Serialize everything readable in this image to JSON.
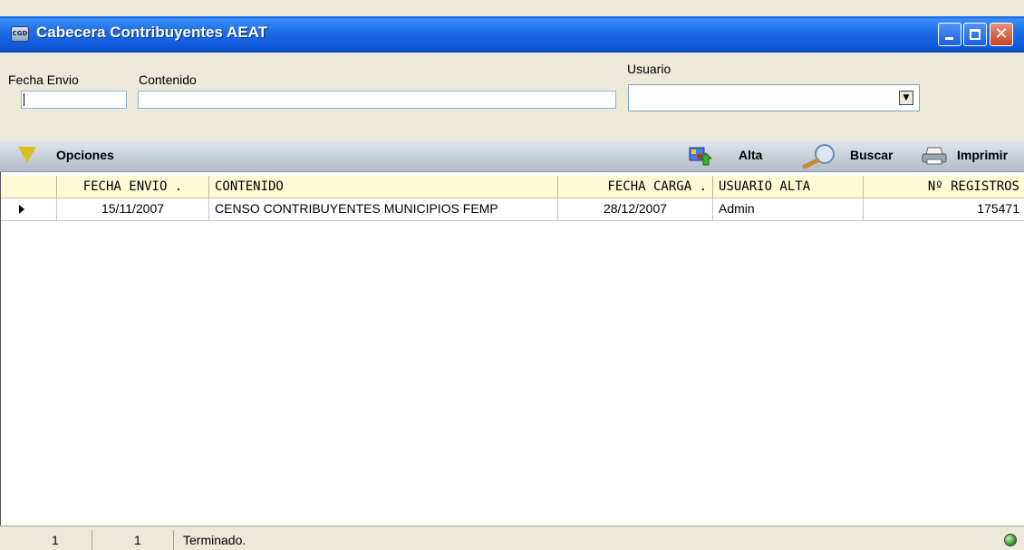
{
  "window": {
    "title": "Cabecera Contribuyentes AEAT",
    "icon_text": "CGD",
    "close_glyph": "✕",
    "dropdown_glyph": "▼"
  },
  "filters": {
    "fecha_envio": {
      "label": "Fecha Envio",
      "value": ""
    },
    "contenido": {
      "label": "Contenido",
      "value": ""
    },
    "usuario": {
      "label": "Usuario",
      "selected": ""
    }
  },
  "toolbar": {
    "options_label": "Opciones",
    "alta_label": "Alta",
    "buscar_label": "Buscar",
    "imprimir_label": "Imprimir"
  },
  "grid": {
    "columns": [
      "FECHA ENVIO .",
      "CONTENIDO",
      "FECHA CARGA .",
      "USUARIO ALTA",
      "Nº REGISTROS"
    ],
    "rows": [
      {
        "fecha_envio": "15/11/2007",
        "contenido": "CENSO CONTRIBUYENTES MUNICIPIOS FEMP",
        "fecha_carga": "28/12/2007",
        "usuario_alta": "Admin",
        "num_registros": "175471"
      }
    ]
  },
  "status": {
    "record_position": "1",
    "record_count": "1",
    "message": "Terminado."
  },
  "colors": {
    "title_bar": "#1f6fe6",
    "grid_header": "#fdfbd6",
    "toolbar": "#c9d1dc"
  }
}
